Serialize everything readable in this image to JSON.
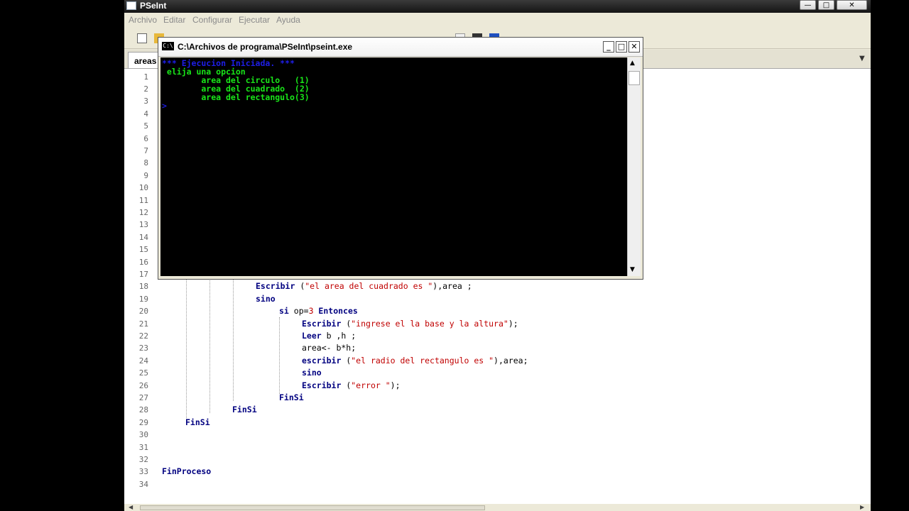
{
  "window": {
    "title": "PSeInt",
    "min_label": "—",
    "max_label": "□",
    "close_label": "✕"
  },
  "menu": [
    "Archivo",
    "Editar",
    "Configurar",
    "Ejecutar",
    "Ayuda"
  ],
  "tab": {
    "label": "areas",
    "menu_arrow": "▼"
  },
  "editor": {
    "line_numbers": [
      "1",
      "2",
      "3",
      "4",
      "5",
      "6",
      "7",
      "8",
      "9",
      "10",
      "11",
      "12",
      "13",
      "14",
      "15",
      "16",
      "17",
      "18",
      "19",
      "20",
      "21",
      "22",
      "23",
      "24",
      "25",
      "26",
      "27",
      "28",
      "29",
      "30",
      "31",
      "32",
      "33",
      "34"
    ],
    "code": {
      "l18_kw": "Escribir",
      "l18_s": "\"el area del cuadrado es \"",
      "l18_t": "),area ;",
      "l18_p": " (",
      "l19_kw": "sino",
      "l20_kw1": "si",
      "l20_t": " op=",
      "l20_n": "3",
      "l20_kw2": " Entonces",
      "l21_kw": "Escribir",
      "l21_p": " (",
      "l21_s": "\"ingrese el la base y la altura\"",
      "l21_t": ");",
      "l22_kw": "Leer",
      "l22_t": " b ,h ;",
      "l23_t": "area<- b*h;",
      "l24_kw": "escribir",
      "l24_p": " (",
      "l24_s": "\"el radio del rectangulo es \"",
      "l24_t": "),area;",
      "l25_kw": "sino",
      "l26_kw": "Escribir",
      "l26_p": " (",
      "l26_s": "\"error \"",
      "l26_t": ");",
      "l27_kw": "FinSi",
      "l28_kw": "FinSi",
      "l29_kw": "FinSi",
      "l33_kw": "FinProceso"
    }
  },
  "console": {
    "title": "C:\\Archivos de programa\\PSeInt\\pseint.exe",
    "icon_label": "C:\\",
    "min_label": "_",
    "max_label": "□",
    "close_label": "✕",
    "lines": [
      "*** Ejecucion Iniciada. ***",
      " elija una opcion",
      "        area del circulo   (1)",
      "        area del cuadrado  (2)",
      "        area del rectangulo(3)",
      ">"
    ],
    "colors": {
      "info": "#1e1ee6",
      "output": "#19e619"
    }
  }
}
